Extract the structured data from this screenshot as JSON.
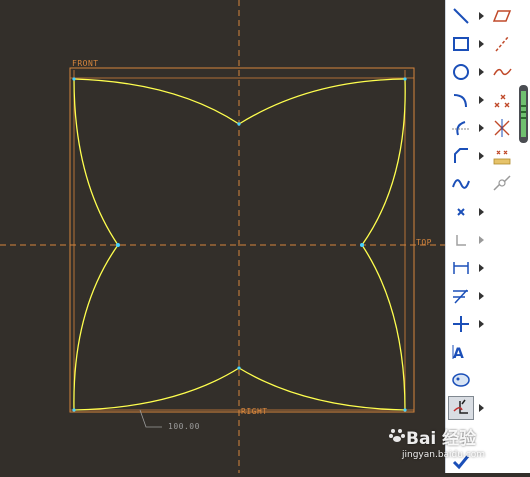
{
  "canvas": {
    "colors": {
      "background": "#332f2a",
      "sketch": "#ffff4e",
      "reference": "#d6853c",
      "dimension": "#9c9c9c",
      "vertex": "#46d0ff"
    },
    "datum_labels": {
      "front": "FRONT",
      "top": "TOP",
      "right": "RIGHT"
    },
    "dimension_value": "100.00"
  },
  "palette": {
    "tools": [
      {
        "name": "line-tool",
        "icon": "line-icon",
        "has_flyout": true
      },
      {
        "name": "rectangle-tool",
        "icon": "rectangle-icon",
        "has_flyout": true
      },
      {
        "name": "circle-tool",
        "icon": "circle-icon",
        "has_flyout": true
      },
      {
        "name": "arc-tool",
        "icon": "arc-icon",
        "has_flyout": true
      },
      {
        "name": "fillet-tool",
        "icon": "fillet-icon",
        "has_flyout": true
      },
      {
        "name": "chamfer-tool",
        "icon": "chamfer-icon",
        "has_flyout": true
      },
      {
        "name": "spline-tool",
        "icon": "spline-icon",
        "has_flyout": false
      },
      {
        "name": "point-tool",
        "icon": "point-icon",
        "has_flyout": true
      },
      {
        "name": "coordinate-system-tool",
        "icon": "coordinate-system-icon",
        "has_flyout": true
      },
      {
        "name": "dimension-tool",
        "icon": "dimension-icon",
        "has_flyout": true
      },
      {
        "name": "modify-tool",
        "icon": "modify-icon",
        "has_flyout": true
      },
      {
        "name": "constraint-tool",
        "icon": "constraint-icon",
        "has_flyout": true
      },
      {
        "name": "text-tool",
        "icon": "text-icon",
        "has_flyout": false
      },
      {
        "name": "palette-tool",
        "icon": "palette-icon",
        "has_flyout": false
      },
      {
        "name": "trim-tool",
        "icon": "trim-icon",
        "has_flyout": true,
        "selected": true
      },
      {
        "name": "done-tool",
        "icon": "checkmark-icon",
        "has_flyout": false
      }
    ],
    "secondary_tools": [
      {
        "name": "parallelogram-tool",
        "icon": "parallelogram-icon"
      },
      {
        "name": "centerline-tool",
        "icon": "centerline-icon"
      },
      {
        "name": "conic-tool",
        "icon": "conic-icon"
      },
      {
        "name": "points-tool",
        "icon": "points-icon"
      },
      {
        "name": "center-points-tool",
        "icon": "center-points-icon"
      },
      {
        "name": "align-points-tool",
        "icon": "align-points-icon"
      },
      {
        "name": "connect-tool",
        "icon": "connect-icon"
      }
    ]
  },
  "watermark": {
    "brand": "Bai 经验",
    "url": "jingyan.baidu.com"
  }
}
